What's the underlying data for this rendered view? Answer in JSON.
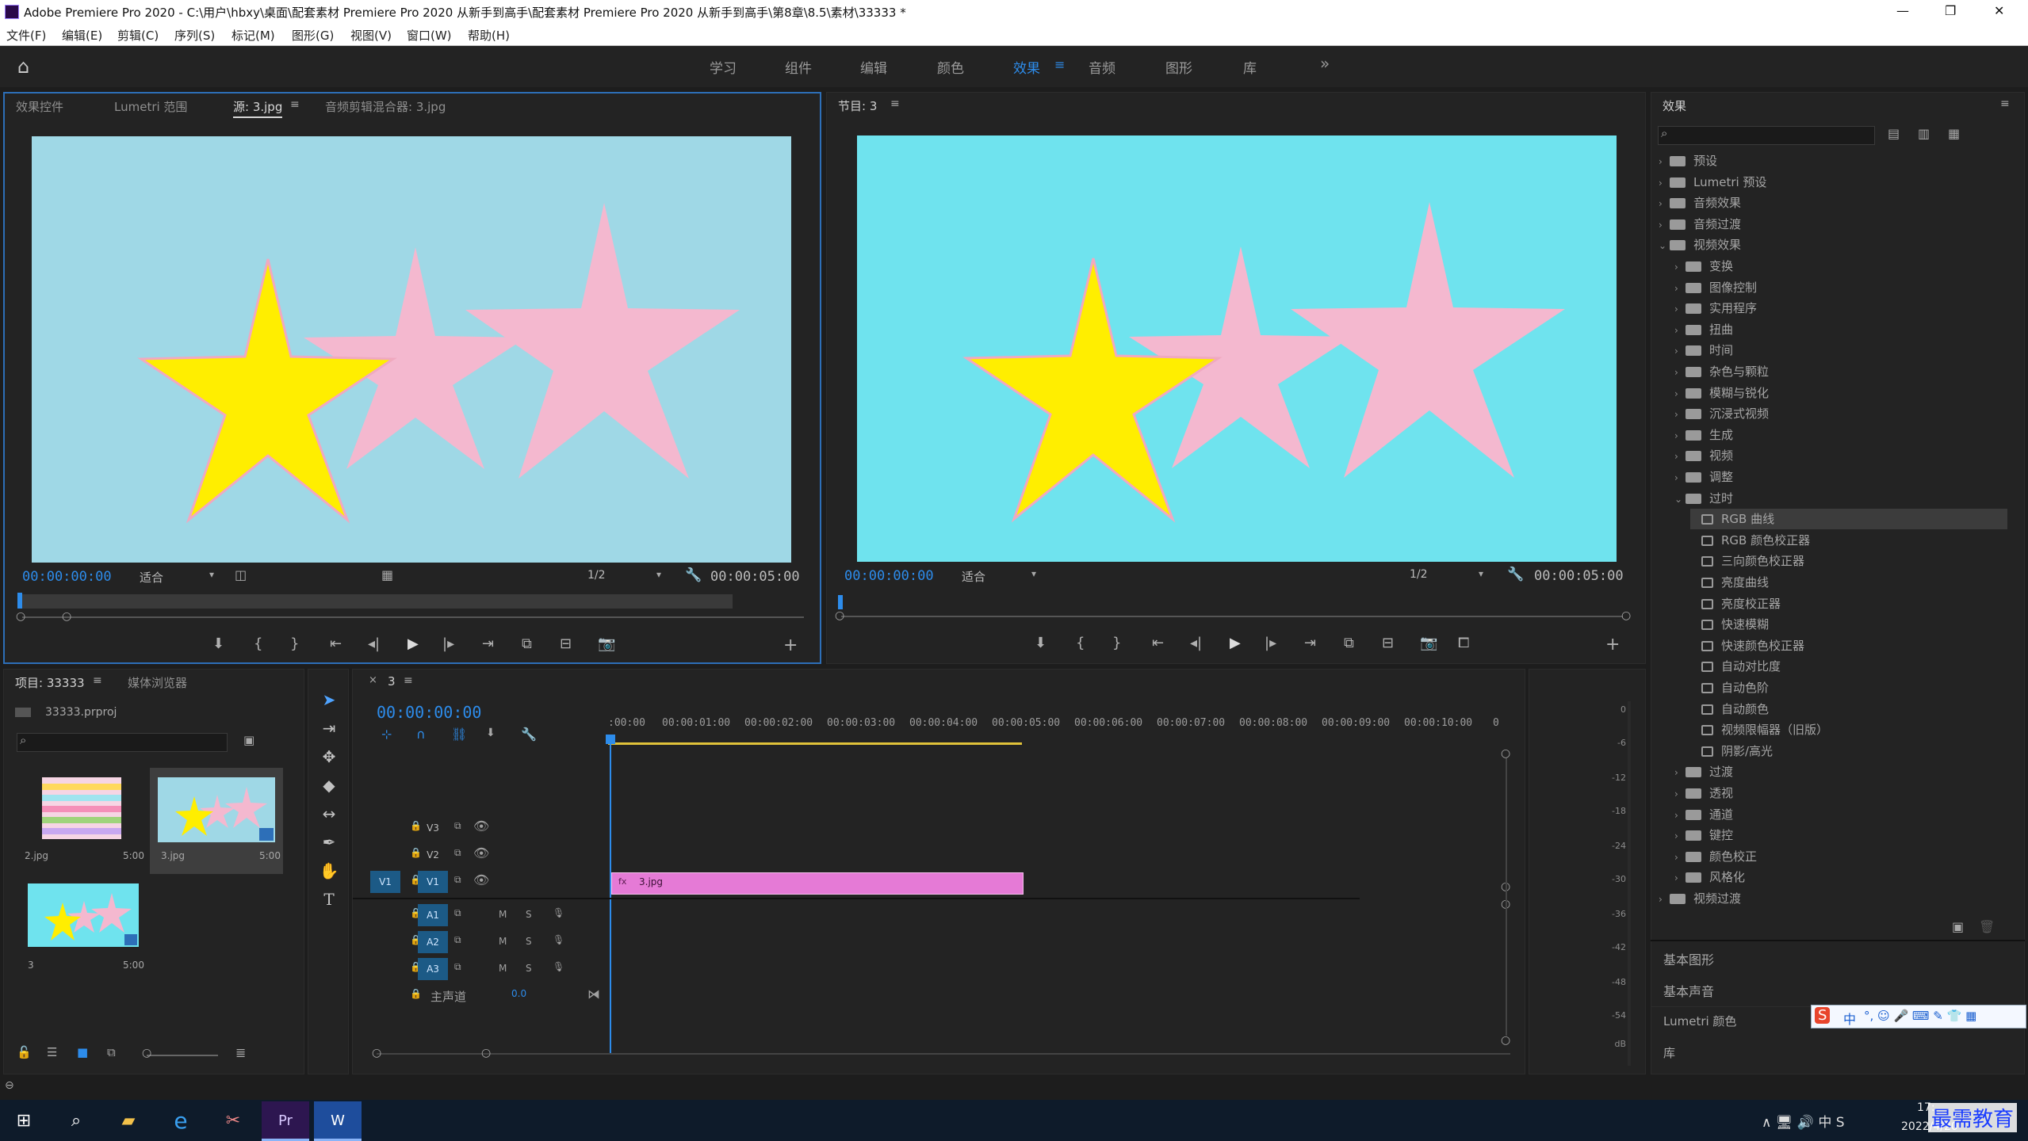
{
  "window": {
    "title": "Adobe Premiere Pro 2020 - C:\\用户\\hbxy\\桌面\\配套素材 Premiere Pro 2020 从新手到高手\\配套素材 Premiere Pro 2020 从新手到高手\\第8章\\8.5\\素材\\33333 *",
    "minimize": "—",
    "maximize": "❐",
    "close": "✕"
  },
  "menu": [
    "文件(F)",
    "编辑(E)",
    "剪辑(C)",
    "序列(S)",
    "标记(M)",
    "图形(G)",
    "视图(V)",
    "窗口(W)",
    "帮助(H)"
  ],
  "workspaces": [
    {
      "label": "学习"
    },
    {
      "label": "组件"
    },
    {
      "label": "编辑"
    },
    {
      "label": "颜色"
    },
    {
      "label": "效果"
    },
    {
      "label": "音频"
    },
    {
      "label": "图形"
    },
    {
      "label": "库"
    },
    {
      "label": "»"
    }
  ],
  "source_monitor": {
    "tabs": [
      "效果控件",
      "Lumetri 范围",
      "源: 3.jpg",
      "音频剪辑混合器: 3.jpg"
    ],
    "timecode_in": "00:00:00:00",
    "fit": "适合",
    "resolution": "1/2",
    "duration": "00:00:05:00",
    "bg_color": "#9fd8e6"
  },
  "program_monitor": {
    "tab": "节目: 3",
    "timecode_in": "00:00:00:00",
    "fit": "适合",
    "resolution": "1/2",
    "duration": "00:00:05:00",
    "bg_color": "#6fe3ee"
  },
  "colors": {
    "accent_blue": "#2d8ceb",
    "star_yellow": "#ffee00",
    "star_pink": "#f4b8cf",
    "clip_pink": "#e57ad6",
    "panel_bg": "#232323"
  },
  "project": {
    "tabs": [
      "项目: 33333",
      "媒体浏览器"
    ],
    "file": "33333.prproj",
    "items": [
      {
        "name": "2.jpg",
        "duration": "5:00"
      },
      {
        "name": "3.jpg",
        "duration": "5:00"
      },
      {
        "name": "3",
        "duration": "5:00"
      }
    ]
  },
  "timeline": {
    "tab": "3",
    "timecode": "00:00:00:00",
    "ruler": [
      ":00:00",
      "00:00:01:00",
      "00:00:02:00",
      "00:00:03:00",
      "00:00:04:00",
      "00:00:05:00",
      "00:00:06:00",
      "00:00:07:00",
      "00:00:08:00",
      "00:00:09:00",
      "00:00:10:00",
      "0"
    ],
    "video_tracks": [
      "V3",
      "V2",
      "V1"
    ],
    "audio_tracks": [
      "A1",
      "A2",
      "A3"
    ],
    "source_patch": "V1",
    "master": {
      "label": "主声道",
      "value": "0.0"
    },
    "mute": "M",
    "solo": "S",
    "clip": {
      "label": "3.jpg",
      "fx": "fx"
    }
  },
  "meter_labels": [
    "0",
    "-6",
    "-12",
    "-18",
    "-24",
    "-30",
    "-36",
    "-42",
    "-48",
    "-54",
    "dB"
  ],
  "effects": {
    "title": "效果",
    "tree": [
      {
        "label": "预设",
        "level": 0,
        "type": "folder",
        "open": false
      },
      {
        "label": "Lumetri 预设",
        "level": 0,
        "type": "folder",
        "open": false
      },
      {
        "label": "音频效果",
        "level": 0,
        "type": "folder",
        "open": false
      },
      {
        "label": "音频过渡",
        "level": 0,
        "type": "folder",
        "open": false
      },
      {
        "label": "视频效果",
        "level": 0,
        "type": "folder",
        "open": true
      },
      {
        "label": "变换",
        "level": 1,
        "type": "folder",
        "open": false
      },
      {
        "label": "图像控制",
        "level": 1,
        "type": "folder",
        "open": false
      },
      {
        "label": "实用程序",
        "level": 1,
        "type": "folder",
        "open": false
      },
      {
        "label": "扭曲",
        "level": 1,
        "type": "folder",
        "open": false
      },
      {
        "label": "时间",
        "level": 1,
        "type": "folder",
        "open": false
      },
      {
        "label": "杂色与颗粒",
        "level": 1,
        "type": "folder",
        "open": false
      },
      {
        "label": "模糊与锐化",
        "level": 1,
        "type": "folder",
        "open": false
      },
      {
        "label": "沉浸式视频",
        "level": 1,
        "type": "folder",
        "open": false
      },
      {
        "label": "生成",
        "level": 1,
        "type": "folder",
        "open": false
      },
      {
        "label": "视频",
        "level": 1,
        "type": "folder",
        "open": false
      },
      {
        "label": "调整",
        "level": 1,
        "type": "folder",
        "open": false
      },
      {
        "label": "过时",
        "level": 1,
        "type": "folder",
        "open": true
      },
      {
        "label": "RGB 曲线",
        "level": 2,
        "type": "fx",
        "selected": true
      },
      {
        "label": "RGB 颜色校正器",
        "level": 2,
        "type": "fx"
      },
      {
        "label": "三向颜色校正器",
        "level": 2,
        "type": "fx"
      },
      {
        "label": "亮度曲线",
        "level": 2,
        "type": "fx"
      },
      {
        "label": "亮度校正器",
        "level": 2,
        "type": "fx"
      },
      {
        "label": "快速模糊",
        "level": 2,
        "type": "fx"
      },
      {
        "label": "快速颜色校正器",
        "level": 2,
        "type": "fx"
      },
      {
        "label": "自动对比度",
        "level": 2,
        "type": "fx"
      },
      {
        "label": "自动色阶",
        "level": 2,
        "type": "fx"
      },
      {
        "label": "自动颜色",
        "level": 2,
        "type": "fx"
      },
      {
        "label": "视频限幅器（旧版）",
        "level": 2,
        "type": "fx"
      },
      {
        "label": "阴影/高光",
        "level": 2,
        "type": "fx"
      },
      {
        "label": "过渡",
        "level": 1,
        "type": "folder",
        "open": false
      },
      {
        "label": "透视",
        "level": 1,
        "type": "folder",
        "open": false
      },
      {
        "label": "通道",
        "level": 1,
        "type": "folder",
        "open": false
      },
      {
        "label": "键控",
        "level": 1,
        "type": "folder",
        "open": false
      },
      {
        "label": "颜色校正",
        "level": 1,
        "type": "folder",
        "open": false
      },
      {
        "label": "风格化",
        "level": 1,
        "type": "folder",
        "open": false
      },
      {
        "label": "视频过渡",
        "level": 0,
        "type": "folder",
        "open": false
      }
    ],
    "sections": [
      "基本图形",
      "基本声音",
      "Lumetri 颜色",
      "库"
    ]
  },
  "ime": {
    "logo": "S",
    "lang": "中"
  },
  "taskbar": {
    "time": "17:",
    "date": "2022/4/20",
    "watermark": "最需教育"
  }
}
